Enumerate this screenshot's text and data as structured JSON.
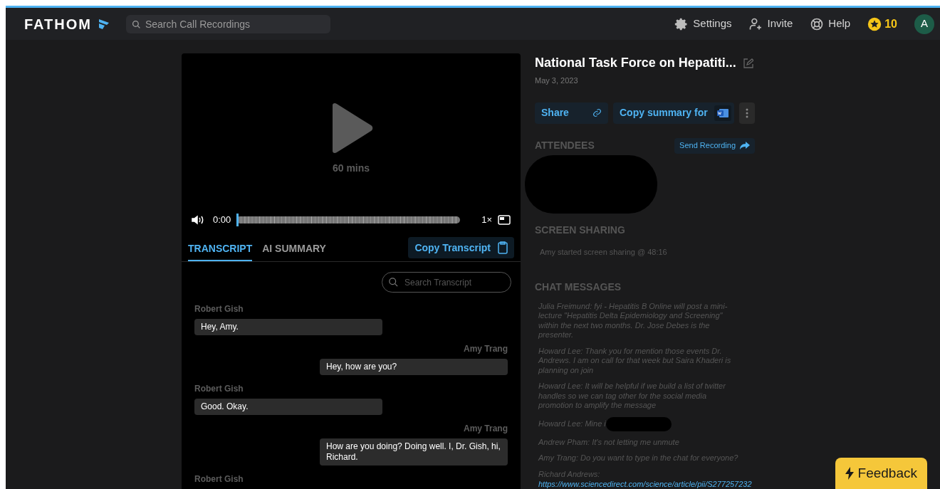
{
  "header": {
    "logo": "FATHOM",
    "search": {
      "placeholder": "Search Call Recordings"
    },
    "nav": [
      {
        "kind": "settings",
        "label": "Settings"
      },
      {
        "kind": "invite",
        "label": "Invite"
      },
      {
        "kind": "help",
        "label": "Help"
      }
    ],
    "points": "10",
    "avatar": "A"
  },
  "player": {
    "duration": "60 mins",
    "time": "0:00",
    "speed": "1×",
    "progress": {
      "level": 0
    }
  },
  "tabs": [
    {
      "label": "TRANSCRIPT",
      "selected": true
    },
    {
      "label": "AI SUMMARY",
      "selected": false
    }
  ],
  "copy_transcript": "Copy Transcript",
  "transcript_search": {
    "placeholder": "Search Transcript"
  },
  "transcript": [
    {
      "kind": "other",
      "speaker": "Robert Gish",
      "text": "Hey, Amy."
    },
    {
      "kind": "self",
      "speaker": "Amy Trang",
      "text": "Hey, how are you?"
    },
    {
      "kind": "other",
      "speaker": "Robert Gish",
      "text": "Good. Okay."
    },
    {
      "kind": "self",
      "speaker": "Amy Trang",
      "text": "How are you doing? Doing well. I, Dr. Gish, hi, Richard."
    },
    {
      "kind": "other",
      "speaker": "Robert Gish"
    }
  ],
  "meeting": {
    "title": "National Task Force on Hepatiti...",
    "date": "May 3, 2023",
    "share": "Share",
    "copy_summary": "Copy summary for"
  },
  "attendees": {
    "title": "ATTENDEES",
    "send": "Send Recording",
    "redacted": true
  },
  "screen_sharing": {
    "title": "SCREEN SHARING",
    "events": [
      "Amy started screen sharing @ 48:16"
    ]
  },
  "chat": {
    "title": "CHAT MESSAGES",
    "messages": [
      {
        "text": "Julia Freimund: fyi - Hepatitis B Online will post a mini-lecture \"Hepatitis Delta Epidemiology and Screening\" within the next two months. Dr. Jose Debes is the presenter.",
        "redacted": false
      },
      {
        "text": "Howard Lee: Thank you for mention those events Dr. Andrews. I am on call for that week but Saira Khaderi is planning on join",
        "redacted": false
      },
      {
        "text": "Howard Lee: It will be helpful if we build a list of twitter handles so we can tag other for the social media promotion to amplify the message",
        "redacted": false
      },
      {
        "text": "Howard Lee: Mine i",
        "redacted": true
      },
      {
        "text": "Andrew Pham: It's not letting me unmute",
        "redacted": false
      },
      {
        "text": "Amy Trang: Do you want to type in the chat for everyone?",
        "redacted": false
      },
      {
        "text": "Richard Andrews:",
        "link": "https://www.sciencedirect.com/science/article/pii/S277257232",
        "redacted": false
      }
    ]
  },
  "feedback": "Feedback"
}
